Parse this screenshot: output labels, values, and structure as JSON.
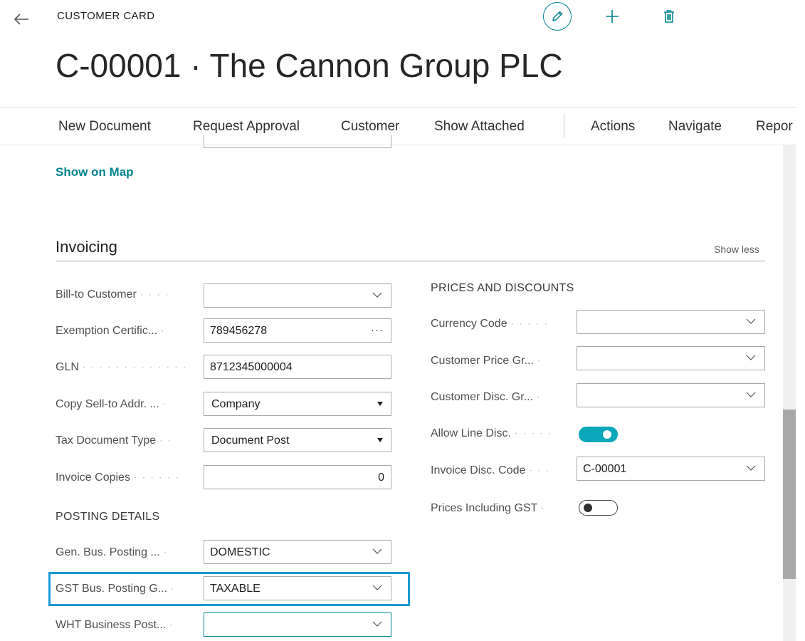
{
  "header": {
    "page_kind": "CUSTOMER CARD",
    "title": "C-00001 · The Cannon Group PLC"
  },
  "icons": {
    "back": "arrow-left-icon",
    "edit": "pencil-icon",
    "new": "plus-icon",
    "delete": "trash-icon"
  },
  "actions": [
    "New Document",
    "Request Approval",
    "Customer",
    "Show Attached",
    "Actions",
    "Navigate",
    "Repor"
  ],
  "show_on_map": "Show on Map",
  "section": {
    "title": "Invoicing",
    "toggle_label": "Show less"
  },
  "left": {
    "fields": [
      {
        "label": "Bill-to Customer",
        "dots": "· · · ·",
        "value": "",
        "control": "lookup"
      },
      {
        "label": "Exemption Certific...",
        "dots": "·",
        "value": "789456278",
        "control": "assist"
      },
      {
        "label": "GLN",
        "dots": "· · · · · · · · · · · · ·",
        "value": "8712345000004",
        "control": "text"
      },
      {
        "label": "Copy Sell-to Addr. ...",
        "dots": "·",
        "value": "Company",
        "control": "select"
      },
      {
        "label": "Tax Document Type",
        "dots": "· ·",
        "value": "Document Post",
        "control": "select"
      },
      {
        "label": "Invoice Copies",
        "dots": "· · · · · ·",
        "value": "0",
        "control": "number"
      }
    ],
    "posting_heading": "POSTING DETAILS",
    "posting_fields": [
      {
        "label": "Gen. Bus. Posting ...",
        "dots": "·",
        "value": "DOMESTIC",
        "control": "lookup"
      },
      {
        "label": "GST Bus. Posting G...",
        "dots": "·",
        "value": "TAXABLE",
        "control": "lookup"
      },
      {
        "label": "WHT Business Post...",
        "dots": "·",
        "value": "",
        "control": "lookup"
      }
    ]
  },
  "right": {
    "heading": "PRICES AND DISCOUNTS",
    "fields": [
      {
        "label": "Currency Code",
        "dots": "· · · · ·",
        "value": "",
        "control": "lookup"
      },
      {
        "label": "Customer Price Gr...",
        "dots": "·",
        "value": "",
        "control": "lookup"
      },
      {
        "label": "Customer Disc. Gr...",
        "dots": "·",
        "value": "",
        "control": "lookup"
      },
      {
        "label": "Allow Line Disc.",
        "dots": "· · · · ·",
        "value": true,
        "control": "toggle"
      },
      {
        "label": "Invoice Disc. Code",
        "dots": "· · ·",
        "value": "C-00001",
        "control": "lookup"
      },
      {
        "label": "Prices Including GST",
        "dots": "·",
        "value": false,
        "control": "toggle"
      }
    ]
  },
  "colors": {
    "accent": "#00838f",
    "toggle_on": "#0aa7b8",
    "highlight": "#1b9ad6"
  }
}
